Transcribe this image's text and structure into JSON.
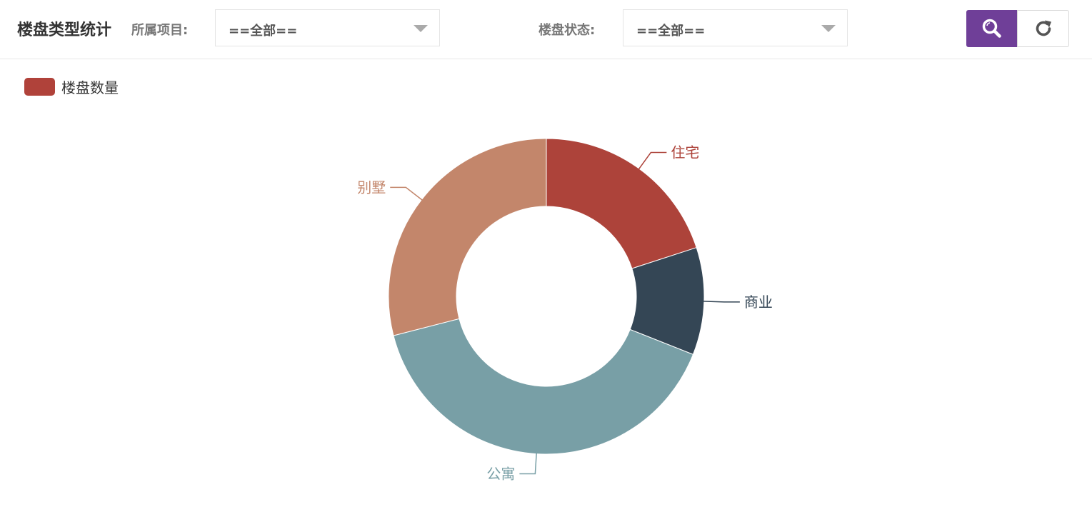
{
  "header": {
    "title": "楼盘类型统计",
    "project_label": "所属项目:",
    "project_value": "==全部==",
    "status_label": "楼盘状态:",
    "status_value": "==全部=="
  },
  "chart_data": {
    "type": "pie",
    "variant": "donut",
    "legend": [
      "楼盘数量"
    ],
    "legend_position": "top-left",
    "series": [
      {
        "name": "楼盘数量",
        "slices": [
          {
            "label": "住宅",
            "value": 20,
            "color": "#ad433a"
          },
          {
            "label": "商业",
            "value": 11,
            "color": "#344655"
          },
          {
            "label": "公寓",
            "value": 40,
            "color": "#789fa6"
          },
          {
            "label": "别墅",
            "value": 29,
            "color": "#c3866b"
          }
        ]
      }
    ]
  },
  "colors": {
    "accent": "#6f3f98",
    "legend_swatch": "#b0423a"
  },
  "icons": {
    "search": "search-icon",
    "refresh": "refresh-icon",
    "dropdown": "chevron-down-icon"
  }
}
